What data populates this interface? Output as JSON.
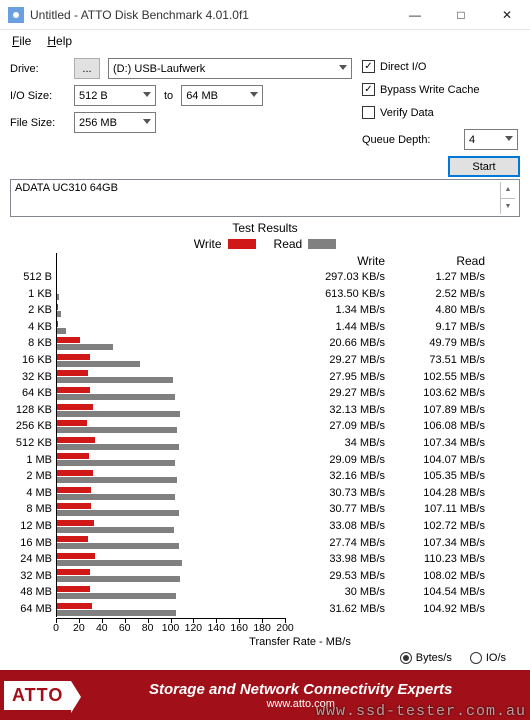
{
  "window": {
    "title": "Untitled - ATTO Disk Benchmark 4.01.0f1"
  },
  "menu": {
    "file": "File",
    "help": "Help"
  },
  "labels": {
    "drive": "Drive:",
    "iosize": "I/O Size:",
    "to": "to",
    "filesize": "File Size:",
    "queue": "Queue Depth:"
  },
  "controls": {
    "drive_dots": "...",
    "drive_value": "(D:) USB-Laufwerk",
    "io_from": "512 B",
    "io_to": "64 MB",
    "file_size": "256 MB",
    "queue_depth": "4"
  },
  "checks": {
    "direct": {
      "label": "Direct I/O",
      "on": true
    },
    "bypass": {
      "label": "Bypass Write Cache",
      "on": true
    },
    "verify": {
      "label": "Verify Data",
      "on": false
    }
  },
  "buttons": {
    "start": "Start"
  },
  "desc": "ADATA UC310 64GB",
  "chart": {
    "title": "Test Results",
    "legend_write": "Write",
    "legend_read": "Read",
    "axis_title": "Transfer Rate - MB/s",
    "xticks": [
      0,
      20,
      40,
      60,
      80,
      100,
      120,
      140,
      160,
      180,
      200
    ],
    "col_write": "Write",
    "col_read": "Read"
  },
  "chart_data": {
    "type": "bar",
    "title": "Test Results",
    "xlabel": "Transfer Rate - MB/s",
    "xlim": [
      0,
      200
    ],
    "categories": [
      "512 B",
      "1 KB",
      "2 KB",
      "4 KB",
      "8 KB",
      "16 KB",
      "32 KB",
      "64 KB",
      "128 KB",
      "256 KB",
      "512 KB",
      "1 MB",
      "2 MB",
      "4 MB",
      "8 MB",
      "12 MB",
      "16 MB",
      "24 MB",
      "32 MB",
      "48 MB",
      "64 MB"
    ],
    "series": [
      {
        "name": "Write",
        "unit": "MB/s",
        "display": [
          "297.03 KB/s",
          "613.50 KB/s",
          "1.34 MB/s",
          "1.44 MB/s",
          "20.66 MB/s",
          "29.27 MB/s",
          "27.95 MB/s",
          "29.27 MB/s",
          "32.13 MB/s",
          "27.09 MB/s",
          "34 MB/s",
          "29.09 MB/s",
          "32.16 MB/s",
          "30.73 MB/s",
          "30.77 MB/s",
          "33.08 MB/s",
          "27.74 MB/s",
          "33.98 MB/s",
          "29.53 MB/s",
          "30 MB/s",
          "31.62 MB/s"
        ],
        "values": [
          0.29,
          0.6,
          1.34,
          1.44,
          20.66,
          29.27,
          27.95,
          29.27,
          32.13,
          27.09,
          34,
          29.09,
          32.16,
          30.73,
          30.77,
          33.08,
          27.74,
          33.98,
          29.53,
          30,
          31.62
        ]
      },
      {
        "name": "Read",
        "unit": "MB/s",
        "display": [
          "1.27 MB/s",
          "2.52 MB/s",
          "4.80 MB/s",
          "9.17 MB/s",
          "49.79 MB/s",
          "73.51 MB/s",
          "102.55 MB/s",
          "103.62 MB/s",
          "107.89 MB/s",
          "106.08 MB/s",
          "107.34 MB/s",
          "104.07 MB/s",
          "105.35 MB/s",
          "104.28 MB/s",
          "107.11 MB/s",
          "102.72 MB/s",
          "107.34 MB/s",
          "110.23 MB/s",
          "108.02 MB/s",
          "104.54 MB/s",
          "104.92 MB/s"
        ],
        "values": [
          1.27,
          2.52,
          4.8,
          9.17,
          49.79,
          73.51,
          102.55,
          103.62,
          107.89,
          106.08,
          107.34,
          104.07,
          105.35,
          104.28,
          107.11,
          102.72,
          107.34,
          110.23,
          108.02,
          104.54,
          104.92
        ]
      }
    ]
  },
  "units": {
    "bytes": "Bytes/s",
    "io": "IO/s",
    "selected": "bytes"
  },
  "footer": {
    "logo": "ATTO",
    "slogan1": "Storage and Network Connectivity Experts",
    "slogan2": "www.atto.com",
    "watermark": "www.ssd-tester.com.au"
  }
}
